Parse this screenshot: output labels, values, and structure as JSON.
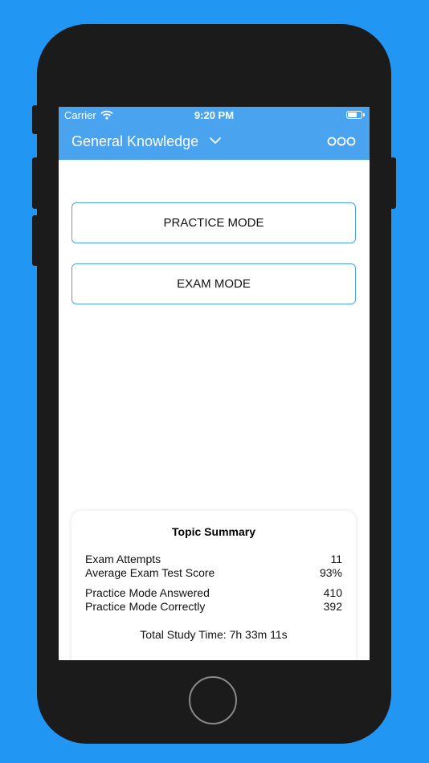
{
  "status_bar": {
    "carrier": "Carrier",
    "time": "9:20 PM"
  },
  "nav": {
    "topic": "General Knowledge",
    "topic_dropdown_icon": "chevron-down-icon",
    "more_icon": "more-dots-icon"
  },
  "modes": {
    "practice_label": "PRACTICE MODE",
    "exam_label": "EXAM MODE"
  },
  "summary": {
    "title": "Topic Summary",
    "rows": [
      {
        "label": "Exam Attempts",
        "value": "11"
      },
      {
        "label": "Average Exam Test Score",
        "value": "93%"
      },
      {
        "label": "Practice Mode Answered",
        "value": "410"
      },
      {
        "label": "Practice Mode Correctly",
        "value": "392"
      }
    ],
    "study_time": "Total Study Time: 7h 33m 11s"
  },
  "colors": {
    "background": "#2196f3",
    "accent": "#4aa3ee",
    "device": "#1b1b1b"
  }
}
